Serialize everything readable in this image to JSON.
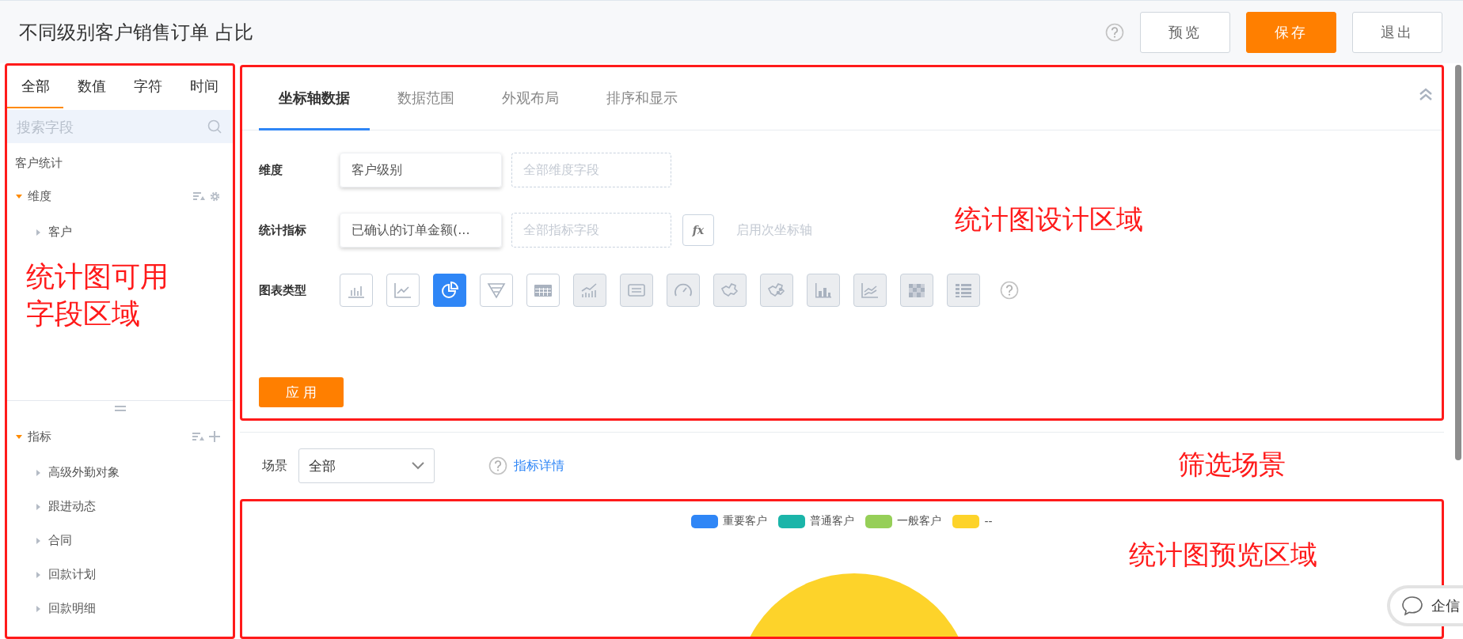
{
  "header": {
    "title": "不同级别客户销售订单 占比",
    "buttons": [
      {
        "label": "预览",
        "kind": "default"
      },
      {
        "label": "保存",
        "kind": "primary"
      },
      {
        "label": "退出",
        "kind": "default"
      }
    ]
  },
  "field_panel": {
    "tabs": [
      {
        "label": "全部",
        "selected": true
      },
      {
        "label": "数值",
        "selected": false
      },
      {
        "label": "字符",
        "selected": false
      },
      {
        "label": "时间",
        "selected": false
      }
    ],
    "search": {
      "placeholder": "搜索字段"
    },
    "group_title": "客户统计",
    "annotation": "统计图可用字段区域",
    "sections": [
      {
        "label": "维度",
        "expanded": true,
        "tools": [
          {
            "kind": "sort"
          },
          {
            "kind": "gear"
          }
        ],
        "children": [
          {
            "label": "客户",
            "expanded": false
          }
        ]
      },
      {
        "label": "指标",
        "expanded": true,
        "tools": [
          {
            "kind": "sort"
          },
          {
            "kind": "plus"
          }
        ],
        "children": [
          {
            "label": "高级外勤对象",
            "expanded": false
          },
          {
            "label": "跟进动态",
            "expanded": false
          },
          {
            "label": "合同",
            "expanded": false
          },
          {
            "label": "回款计划",
            "expanded": false
          },
          {
            "label": "回款明细",
            "expanded": false
          }
        ]
      }
    ]
  },
  "design_panel": {
    "tabs": [
      {
        "label": "坐标轴数据",
        "selected": true
      },
      {
        "label": "数据范围",
        "selected": false
      },
      {
        "label": "外观布局",
        "selected": false
      },
      {
        "label": "排序和显示",
        "selected": false
      }
    ],
    "annotation": "统计图设计区域",
    "dimension": {
      "label": "维度",
      "chip": "客户级别",
      "slot_placeholder": "全部维度字段"
    },
    "metric": {
      "label": "统计指标",
      "chip": "已确认的订单金额(...",
      "slot_placeholder": "全部指标字段",
      "formula_button": "fx",
      "secondary_axis": {
        "label": "启用次坐标轴",
        "disabled": true
      }
    },
    "chart_type": {
      "label": "图表类型",
      "types": [
        {
          "kind": "bar",
          "selected": false,
          "disabled": false
        },
        {
          "kind": "line",
          "selected": false,
          "disabled": false
        },
        {
          "kind": "pie",
          "selected": true,
          "disabled": false
        },
        {
          "kind": "funnel",
          "selected": false,
          "disabled": false
        },
        {
          "kind": "table",
          "selected": false,
          "disabled": false
        },
        {
          "kind": "combo",
          "selected": false,
          "disabled": true
        },
        {
          "kind": "text",
          "selected": false,
          "disabled": true
        },
        {
          "kind": "gauge",
          "selected": false,
          "disabled": true
        },
        {
          "kind": "map",
          "selected": false,
          "disabled": true
        },
        {
          "kind": "mappoints",
          "selected": false,
          "disabled": true
        },
        {
          "kind": "stacked",
          "selected": false,
          "disabled": true
        },
        {
          "kind": "area",
          "selected": false,
          "disabled": true
        },
        {
          "kind": "heatmap",
          "selected": false,
          "disabled": true
        },
        {
          "kind": "pivot",
          "selected": false,
          "disabled": true
        }
      ]
    },
    "apply_button": "应 用"
  },
  "filter_bar": {
    "label": "场景",
    "select_value": "全部",
    "link": "指标详情",
    "annotation": "筛选场景"
  },
  "preview": {
    "annotation": "统计图预览区域",
    "legend": [
      {
        "label": "重要客户",
        "color": "#2f86f6"
      },
      {
        "label": "普通客户",
        "color": "#1bb5a9"
      },
      {
        "label": "一般客户",
        "color": "#96cf58"
      },
      {
        "label": "--",
        "color": "#fdd32a"
      }
    ]
  },
  "chat_widget": {
    "label": "企信"
  }
}
